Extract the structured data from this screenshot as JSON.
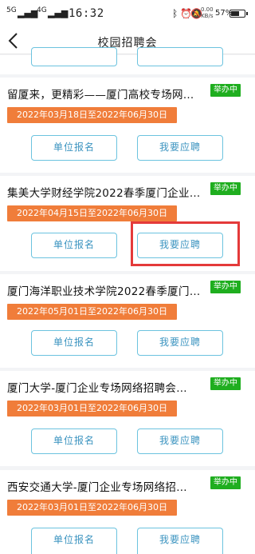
{
  "status_bar": {
    "sig1": "5G",
    "sig2": "4G",
    "time": "16:32",
    "speed_value": "0.00",
    "speed_unit": "KB/s",
    "battery": "57%"
  },
  "header": {
    "title": "校园招聘会"
  },
  "jobs": [
    {
      "title": "留厦来，更精彩——厦门高校专场网…",
      "status": "举办中",
      "date": "2022年03月18日至2022年06月30日",
      "register_label": "单位报名",
      "apply_label": "我要应聘"
    },
    {
      "title": "集美大学财经学院2022春季厦门企业…",
      "status": "举办中",
      "date": "2022年04月15日至2022年06月30日",
      "register_label": "单位报名",
      "apply_label": "我要应聘"
    },
    {
      "title": "厦门海洋职业技术学院2022春季厦门…",
      "status": "举办中",
      "date": "2022年05月01日至2022年06月30日",
      "register_label": "单位报名",
      "apply_label": "我要应聘"
    },
    {
      "title": "厦门大学-厦门企业专场网络招聘会…",
      "status": "举办中",
      "date": "2022年03月01日至2022年06月30日",
      "register_label": "单位报名",
      "apply_label": "我要应聘"
    },
    {
      "title": "西安交通大学-厦门企业专场网络招…",
      "status": "举办中",
      "date": "2022年03月01日至2022年06月30日",
      "register_label": "单位报名",
      "apply_label": "我要应聘"
    }
  ]
}
